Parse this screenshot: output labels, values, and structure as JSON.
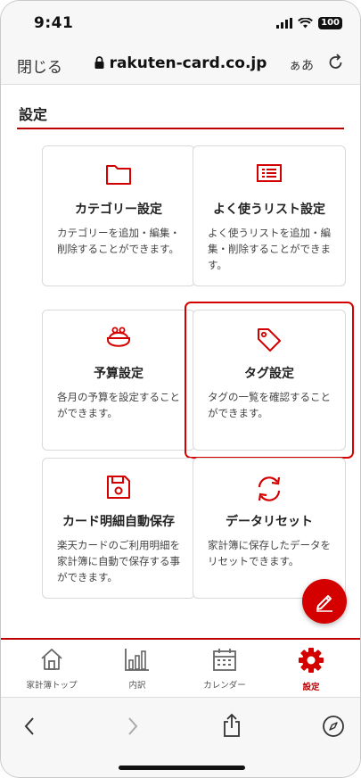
{
  "status_bar": {
    "time": "9:41",
    "battery": "100"
  },
  "browser": {
    "close_label": "閉じる",
    "domain": "rakuten-card.co.jp",
    "text_size_label": "ぁあ"
  },
  "page": {
    "title": "設定"
  },
  "cards": [
    {
      "title": "カテゴリー設定",
      "desc": "カテゴリーを追加・編集・削除することができます。",
      "icon": "folder-icon"
    },
    {
      "title": "よく使うリスト設定",
      "desc": "よく使うリストを追加・編集・削除することができます。",
      "icon": "list-icon"
    },
    {
      "title": "予算設定",
      "desc": "各月の予算を設定することができます。",
      "icon": "coin-purse-icon"
    },
    {
      "title": "タグ設定",
      "desc": "タグの一覧を確認することができます。",
      "icon": "tag-icon",
      "selected": true
    },
    {
      "title": "カード明細自動保存",
      "desc": "楽天カードのご利用明細を家計簿に自動で保存する事ができます。",
      "icon": "save-icon"
    },
    {
      "title": "データリセット",
      "desc": "家計簿に保存したデータをリセットできます。",
      "icon": "reset-icon"
    }
  ],
  "nav": [
    {
      "label": "家計簿トップ",
      "icon": "home-icon"
    },
    {
      "label": "内訳",
      "icon": "bar-chart-icon"
    },
    {
      "label": "カレンダー",
      "icon": "calendar-icon"
    },
    {
      "label": "設定",
      "icon": "gear-icon",
      "active": true
    }
  ],
  "colors": {
    "accent": "#bf0000",
    "selected_border": "#d40000",
    "fab": "#d40000"
  }
}
